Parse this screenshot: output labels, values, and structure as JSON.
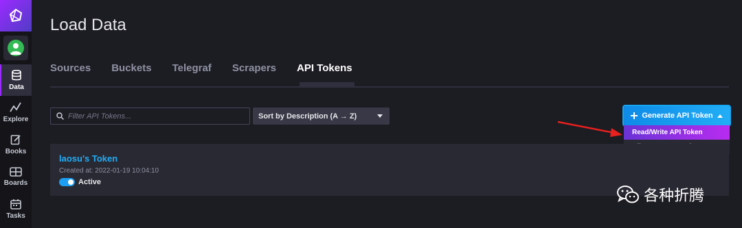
{
  "sidebar": {
    "items": [
      {
        "label": "Data",
        "icon": "database-icon",
        "active": true
      },
      {
        "label": "Explore",
        "icon": "graph-icon",
        "active": false
      },
      {
        "label": "Books",
        "icon": "notebook-icon",
        "active": false
      },
      {
        "label": "Boards",
        "icon": "dashboard-icon",
        "active": false
      },
      {
        "label": "Tasks",
        "icon": "calendar-icon",
        "active": false
      }
    ]
  },
  "header": {
    "title": "Load Data"
  },
  "tabs": [
    {
      "label": "Sources"
    },
    {
      "label": "Buckets"
    },
    {
      "label": "Telegraf"
    },
    {
      "label": "Scrapers"
    },
    {
      "label": "API Tokens"
    }
  ],
  "toolbar": {
    "filter_placeholder": "Filter API Tokens...",
    "sort_label": "Sort by Description (A → Z)",
    "generate_label": "Generate API Token"
  },
  "dropdown": {
    "items": [
      {
        "label": "Read/Write API Token"
      },
      {
        "label": "All Access API Token"
      }
    ]
  },
  "tokens": [
    {
      "name": "laosu's Token",
      "created": "Created at: 2022-01-19 10:04:10",
      "status": "Active"
    }
  ],
  "watermark": {
    "text": "各种折腾"
  },
  "colors": {
    "accent_blue": "#22adf6",
    "accent_purple": "#9b2aff",
    "annotation_red": "#e8201e",
    "background": "#1c1c23"
  }
}
